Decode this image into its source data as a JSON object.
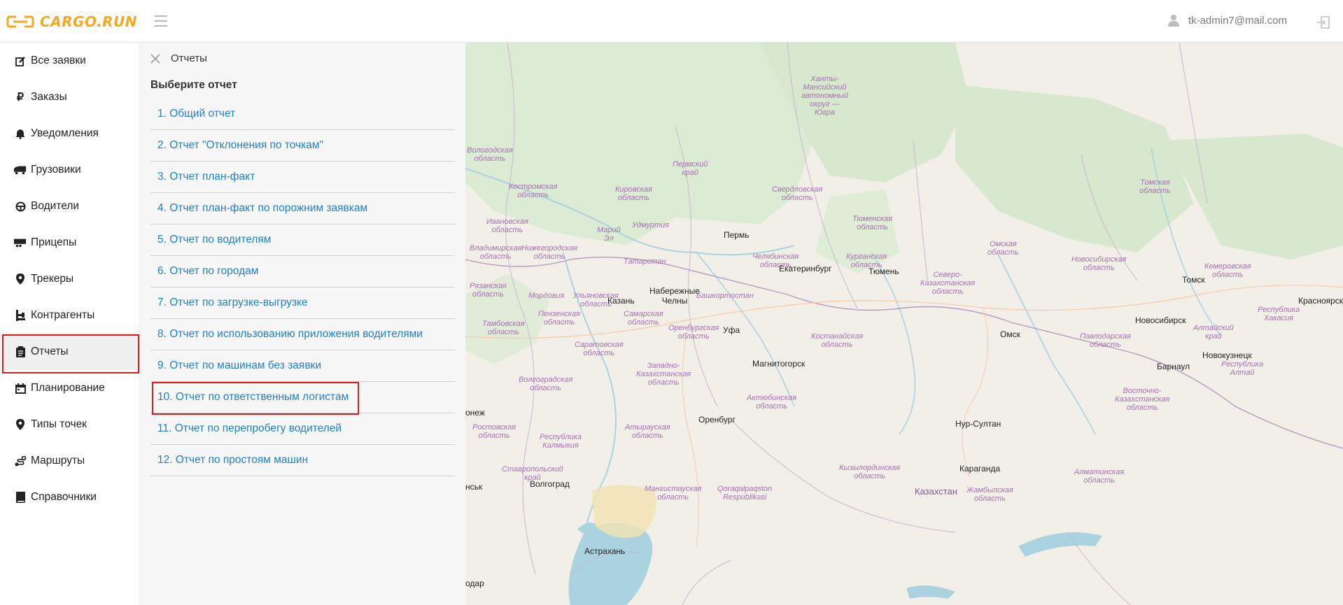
{
  "app": {
    "brand": "CARGO.RUN"
  },
  "header": {
    "user_email": "tk-admin7@mail.com"
  },
  "sidebar": {
    "items": [
      {
        "label": "Все заявки",
        "icon": "edit-icon"
      },
      {
        "label": "Заказы",
        "icon": "ruble-icon"
      },
      {
        "label": "Уведомления",
        "icon": "bell-icon"
      },
      {
        "label": "Грузовики",
        "icon": "truck-icon"
      },
      {
        "label": "Водители",
        "icon": "steering-wheel-icon"
      },
      {
        "label": "Прицепы",
        "icon": "trailer-icon"
      },
      {
        "label": "Трекеры",
        "icon": "map-pin-icon"
      },
      {
        "label": "Контрагенты",
        "icon": "org-icon"
      },
      {
        "label": "Отчеты",
        "icon": "clipboard-icon",
        "active": true
      },
      {
        "label": "Планирование",
        "icon": "calendar-icon"
      },
      {
        "label": "Типы точек",
        "icon": "map-pin-icon"
      },
      {
        "label": "Маршруты",
        "icon": "route-icon"
      },
      {
        "label": "Справочники",
        "icon": "book-icon"
      }
    ]
  },
  "reports_panel": {
    "title": "Отчеты",
    "subtitle": "Выберите отчет",
    "items": [
      "1. Общий отчет",
      "2. Отчет \"Отклонения по точкам\"",
      "3. Отчет план-факт",
      "4. Отчет план-факт по порожним заявкам",
      "5. Отчет по водителям",
      "6. Отчет по городам",
      "7. Отчет по загрузке-выгрузке",
      "8. Отчет по использованию приложения водителями",
      "9. Отчет по машинам без заявки",
      "10. Отчет по ответственным логистам",
      "11. Отчет по перепробегу водителей",
      "12. Отчет по простоям машин"
    ],
    "highlighted_index": 9
  },
  "map": {
    "region_labels": [
      "Ханты-\nМансийский\nавтономный\nокруг —\nЮгра",
      "Вологодская\nобласть",
      "Пермский\nкрай",
      "Костромская\nобласть",
      "Кировская\nобласть",
      "Свердловская\nобласть",
      "Тюменская\nобласть",
      "Томская\nобласть",
      "Ивановская\nобласть",
      "Удмуртия",
      "Марий\nЭл",
      "Омская\nобласть",
      "Владимирская\nобласть",
      "Нижегородская\nобласть",
      "Татарстан",
      "Челябинская\nобласть",
      "Курганская\nобласть",
      "Новосибирская\nобласть",
      "Кемеровская\nобласть",
      "Рязанская\nобласть",
      "Мордовия",
      "Ульяновская\nобласть",
      "Башкортостан",
      "Северо-\nКазахстанская\nобласть",
      "Пензенская\nобласть",
      "Самарская\nобласть",
      "Республика\nХакасия",
      "Тамбовская\nобласть",
      "Оренбургская\nобласть",
      "Костанайская\nобласть",
      "Павлодарская\nобласть",
      "Алтайский\nкрай",
      "Саратовская\nобласть",
      "Республика\nАлтай",
      "Западно-\nКазахстанская\nобласть",
      "Волгоградская\nобласть",
      "Актюбинская\nобласть",
      "Восточно-\nКазахстанская\nобласть",
      "Ростовская\nобласть",
      "Атырауская\nобласть",
      "Республика\nКалмыкия",
      "Ставропольский\nкрай",
      "Кызылординская\nобласть",
      "Алматинская\nобласть",
      "Мангистауская\nобласть",
      "Qoraqalpaqston\nRespublikasi",
      "Жамбылская\nобласть"
    ],
    "cities": [
      "Пермь",
      "Екатеринбург",
      "Тюмень",
      "Томск",
      "Красноярск",
      "Казань",
      "Набережные\nЧелны",
      "Омск",
      "Новосибирск",
      "Уфа",
      "Новокузнецк",
      "Магнитогорск",
      "Барнаул",
      "Оренбург",
      "Нур-Султан",
      "Караганда",
      "Волгоград",
      "Астрахань"
    ],
    "countries": [
      "Казахстан"
    ],
    "edge_fragments": [
      "онеж",
      "нськ",
      "одар"
    ]
  }
}
